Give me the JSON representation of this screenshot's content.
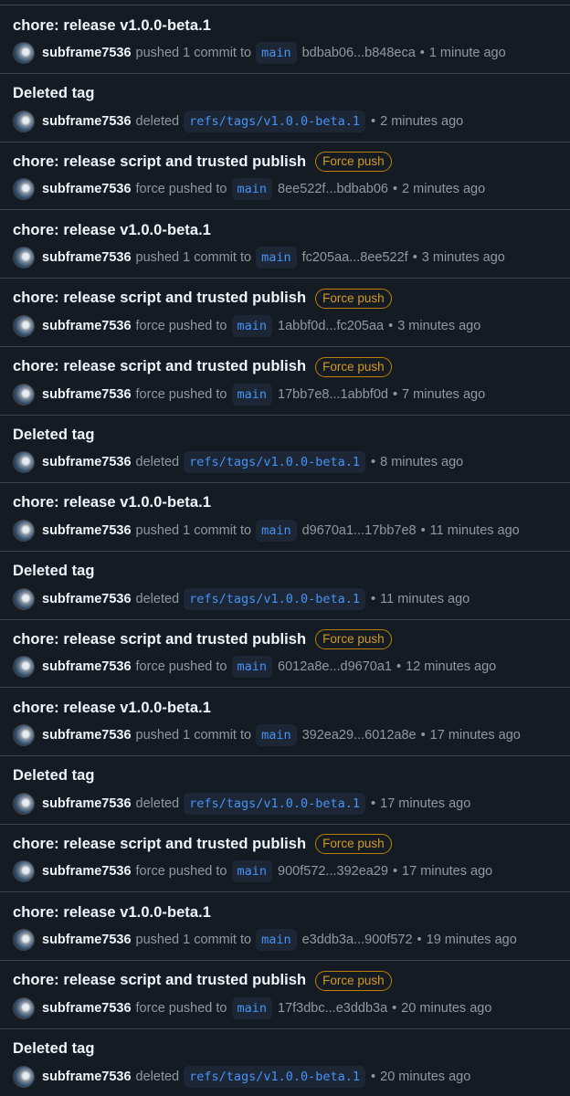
{
  "user": "subframe7536",
  "badge_label": "Force push",
  "separator": "•",
  "items": [
    {
      "title": "chore: release v1.0.0-beta.1",
      "force": false,
      "action": "pushed 1 commit to",
      "ref": "main",
      "sha": "bdbab06...b848eca",
      "time": "1 minute ago"
    },
    {
      "title": "Deleted tag",
      "force": false,
      "action": "deleted",
      "ref": "refs/tags/v1.0.0-beta.1",
      "sha": "",
      "time": "2 minutes ago"
    },
    {
      "title": "chore: release script and trusted publish",
      "force": true,
      "action": "force pushed to",
      "ref": "main",
      "sha": "8ee522f...bdbab06",
      "time": "2 minutes ago"
    },
    {
      "title": "chore: release v1.0.0-beta.1",
      "force": false,
      "action": "pushed 1 commit to",
      "ref": "main",
      "sha": "fc205aa...8ee522f",
      "time": "3 minutes ago"
    },
    {
      "title": "chore: release script and trusted publish",
      "force": true,
      "action": "force pushed to",
      "ref": "main",
      "sha": "1abbf0d...fc205aa",
      "time": "3 minutes ago"
    },
    {
      "title": "chore: release script and trusted publish",
      "force": true,
      "action": "force pushed to",
      "ref": "main",
      "sha": "17bb7e8...1abbf0d",
      "time": "7 minutes ago"
    },
    {
      "title": "Deleted tag",
      "force": false,
      "action": "deleted",
      "ref": "refs/tags/v1.0.0-beta.1",
      "sha": "",
      "time": "8 minutes ago"
    },
    {
      "title": "chore: release v1.0.0-beta.1",
      "force": false,
      "action": "pushed 1 commit to",
      "ref": "main",
      "sha": "d9670a1...17bb7e8",
      "time": "11 minutes ago"
    },
    {
      "title": "Deleted tag",
      "force": false,
      "action": "deleted",
      "ref": "refs/tags/v1.0.0-beta.1",
      "sha": "",
      "time": "11 minutes ago"
    },
    {
      "title": "chore: release script and trusted publish",
      "force": true,
      "action": "force pushed to",
      "ref": "main",
      "sha": "6012a8e...d9670a1",
      "time": "12 minutes ago"
    },
    {
      "title": "chore: release v1.0.0-beta.1",
      "force": false,
      "action": "pushed 1 commit to",
      "ref": "main",
      "sha": "392ea29...6012a8e",
      "time": "17 minutes ago"
    },
    {
      "title": "Deleted tag",
      "force": false,
      "action": "deleted",
      "ref": "refs/tags/v1.0.0-beta.1",
      "sha": "",
      "time": "17 minutes ago"
    },
    {
      "title": "chore: release script and trusted publish",
      "force": true,
      "action": "force pushed to",
      "ref": "main",
      "sha": "900f572...392ea29",
      "time": "17 minutes ago"
    },
    {
      "title": "chore: release v1.0.0-beta.1",
      "force": false,
      "action": "pushed 1 commit to",
      "ref": "main",
      "sha": "e3ddb3a...900f572",
      "time": "19 minutes ago"
    },
    {
      "title": "chore: release script and trusted publish",
      "force": true,
      "action": "force pushed to",
      "ref": "main",
      "sha": "17f3dbc...e3ddb3a",
      "time": "20 minutes ago"
    },
    {
      "title": "Deleted tag",
      "force": false,
      "action": "deleted",
      "ref": "refs/tags/v1.0.0-beta.1",
      "sha": "",
      "time": "20 minutes ago"
    }
  ]
}
